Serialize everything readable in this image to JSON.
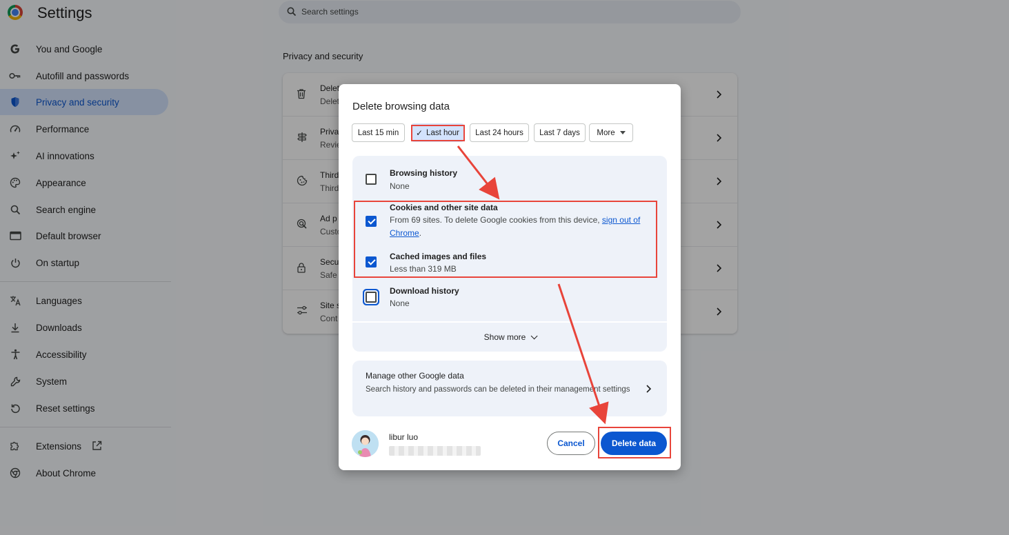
{
  "app": {
    "title": "Settings",
    "search_placeholder": "Search settings"
  },
  "sidebar": {
    "items": [
      {
        "label": "You and Google",
        "icon": "google-g-icon"
      },
      {
        "label": "Autofill and passwords",
        "icon": "key-icon"
      },
      {
        "label": "Privacy and security",
        "icon": "shield-icon",
        "active": true
      },
      {
        "label": "Performance",
        "icon": "speedometer-icon"
      },
      {
        "label": "AI innovations",
        "icon": "sparkle-icon"
      },
      {
        "label": "Appearance",
        "icon": "palette-icon"
      },
      {
        "label": "Search engine",
        "icon": "search-icon"
      },
      {
        "label": "Default browser",
        "icon": "browser-window-icon"
      },
      {
        "label": "On startup",
        "icon": "power-icon"
      },
      {
        "label": "Languages",
        "icon": "translate-icon"
      },
      {
        "label": "Downloads",
        "icon": "download-icon"
      },
      {
        "label": "Accessibility",
        "icon": "accessibility-icon"
      },
      {
        "label": "System",
        "icon": "wrench-icon"
      },
      {
        "label": "Reset settings",
        "icon": "reset-icon"
      },
      {
        "label": "Extensions",
        "icon": "puzzle-icon"
      },
      {
        "label": "About Chrome",
        "icon": "chrome-icon"
      }
    ]
  },
  "main": {
    "section_title": "Privacy and security",
    "rows": [
      {
        "title": "Delet",
        "subtitle": "Delet",
        "icon": "trash-icon"
      },
      {
        "title": "Priva",
        "subtitle": "Revie",
        "icon": "signpost-icon"
      },
      {
        "title": "Third",
        "subtitle": "Third",
        "icon": "cookie-icon"
      },
      {
        "title": "Ad p",
        "subtitle": "Custo",
        "icon": "ad-privacy-icon"
      },
      {
        "title": "Secu",
        "subtitle": "Safe",
        "icon": "lock-icon"
      },
      {
        "title": "Site s",
        "subtitle": "Cont",
        "icon": "sliders-icon"
      }
    ]
  },
  "dialog": {
    "title": "Delete browsing data",
    "time_ranges": [
      {
        "label": "Last 15 min",
        "selected": false
      },
      {
        "label": "Last hour",
        "selected": true
      },
      {
        "label": "Last 24 hours",
        "selected": false
      },
      {
        "label": "Last 7 days",
        "selected": false
      },
      {
        "label": "More",
        "selected": false
      }
    ],
    "options": [
      {
        "title": "Browsing history",
        "desc": "None",
        "checked": false
      },
      {
        "title": "Cookies and other site data",
        "desc_prefix": "From 69 sites. To delete Google cookies from this device, ",
        "desc_link": "sign out of Chrome",
        "desc_suffix": ".",
        "checked": true
      },
      {
        "title": "Cached images and files",
        "desc": "Less than 319 MB",
        "checked": true
      },
      {
        "title": "Download history",
        "desc": "None",
        "checked": false
      }
    ],
    "show_more": "Show more",
    "manage": {
      "title": "Manage other Google data",
      "desc": "Search history and passwords can be deleted in their management settings"
    },
    "account": {
      "name": "libur luo"
    },
    "cancel_label": "Cancel",
    "delete_label": "Delete data"
  },
  "colors": {
    "accent": "#0b57d0",
    "annotation": "#e8443a"
  }
}
